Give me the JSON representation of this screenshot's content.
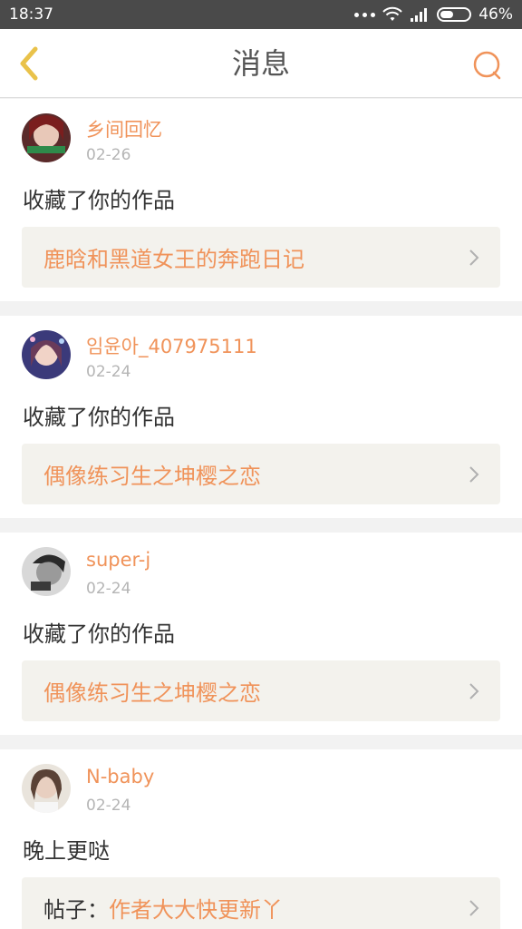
{
  "status_bar": {
    "time": "18:37",
    "battery_percent": "46%",
    "battery_level": 0.46
  },
  "header": {
    "title": "消息"
  },
  "colors": {
    "accent": "#f0935a",
    "back_icon": "#e9c24a",
    "card_link_bg": "#f3f2ed"
  },
  "notifications": [
    {
      "username": "乡间回忆",
      "date": "02-26",
      "action": "收藏了你的作品",
      "work_title": "鹿晗和黑道女王的奔跑日记",
      "work_prefix": ""
    },
    {
      "username": "임윤아_407975111",
      "date": "02-24",
      "action": "收藏了你的作品",
      "work_title": "偶像练习生之坤樱之恋",
      "work_prefix": ""
    },
    {
      "username": "super-j",
      "date": "02-24",
      "action": "收藏了你的作品",
      "work_title": "偶像练习生之坤樱之恋",
      "work_prefix": ""
    },
    {
      "username": "N-baby",
      "date": "02-24",
      "action": "晚上更哒",
      "work_title": "作者大大快更新丫",
      "work_prefix": "帖子："
    }
  ],
  "icons": [
    "back-arrow-icon",
    "search-icon",
    "chevron-right-icon",
    "wifi-icon",
    "signal-icon",
    "battery-icon",
    "more-dots-icon"
  ]
}
